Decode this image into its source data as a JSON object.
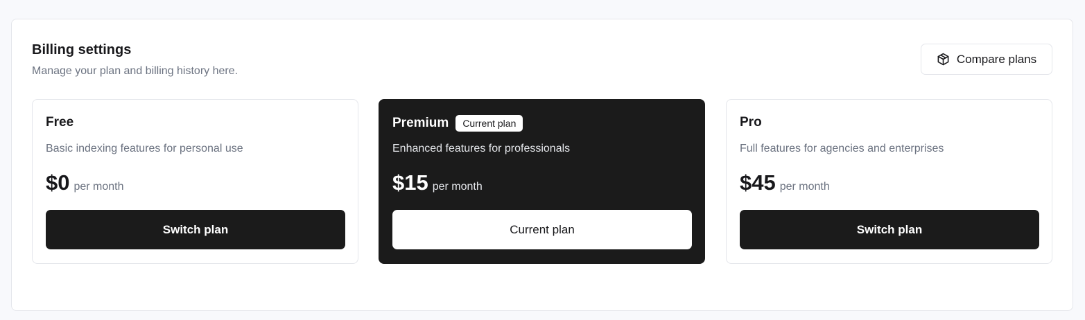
{
  "header": {
    "title": "Billing settings",
    "subtitle": "Manage your plan and billing history here.",
    "compare_label": "Compare plans",
    "compare_icon": "box-icon"
  },
  "plans": [
    {
      "name": "Free",
      "badge": "",
      "description": "Basic indexing features for personal use",
      "price": "$0",
      "period": "per month",
      "button": "Switch plan",
      "current": false
    },
    {
      "name": "Premium",
      "badge": "Current plan",
      "description": "Enhanced features for professionals",
      "price": "$15",
      "period": "per month",
      "button": "Current plan",
      "current": true
    },
    {
      "name": "Pro",
      "badge": "",
      "description": "Full features for agencies and enterprises",
      "price": "$45",
      "period": "per month",
      "button": "Switch plan",
      "current": false
    }
  ],
  "colors": {
    "background": "#f8f9fc",
    "panel": "#ffffff",
    "featured_card": "#1b1b1b",
    "muted_text": "#6b7280",
    "border": "#e4e6eb"
  }
}
